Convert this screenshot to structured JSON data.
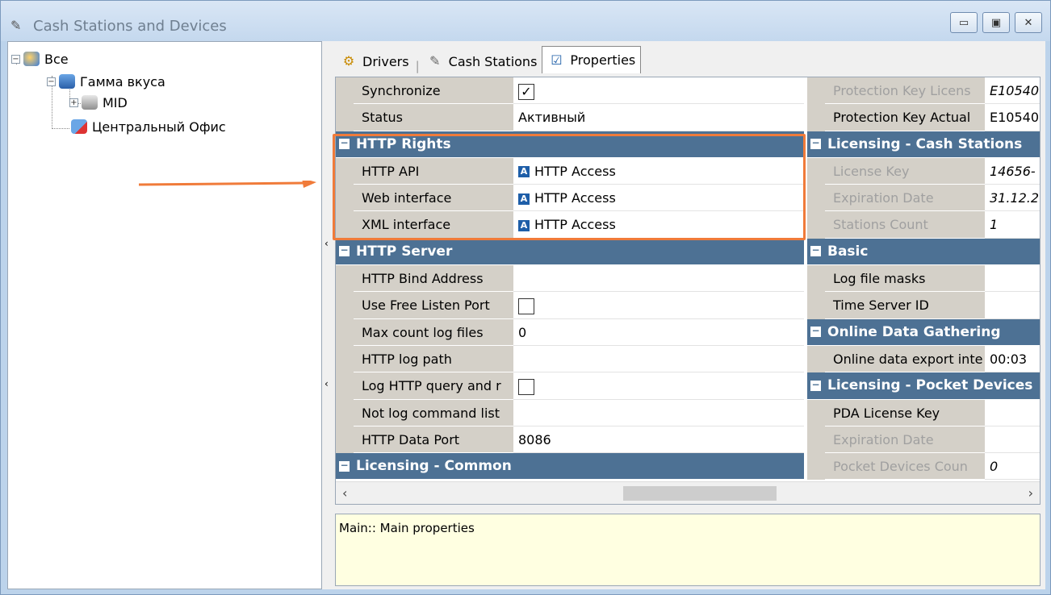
{
  "window": {
    "title": "Cash Stations and Devices",
    "title_icon": "cash-station-icon",
    "buttons": {
      "minimize": "▭",
      "maximize": "▣",
      "close": "✕"
    }
  },
  "tree": {
    "root": {
      "label": "Все",
      "icon": "globe-group-icon"
    },
    "group": {
      "label": "Гамма вкуса",
      "icon": "group-icon"
    },
    "child": {
      "label": "MID",
      "icon": "cash-register-icon"
    },
    "office": {
      "label": "Центральный Офис",
      "icon": "office-icon"
    }
  },
  "tabs": [
    {
      "label": "Drivers",
      "icon": "drivers-icon"
    },
    {
      "label": "Cash Stations",
      "icon": "cash-station-icon"
    },
    {
      "label": "Properties",
      "icon": "properties-icon"
    }
  ],
  "grid_left": {
    "synchronize": {
      "name": "Synchronize",
      "checked": true
    },
    "status": {
      "name": "Status",
      "value": "Активный"
    },
    "cat_http_rights": "HTTP Rights",
    "http_api": {
      "name": "HTTP API",
      "value": "HTTP Access"
    },
    "web_interface": {
      "name": "Web interface",
      "value": "HTTP Access"
    },
    "xml_interface": {
      "name": "XML interface",
      "value": "HTTP Access"
    },
    "cat_http_server": "HTTP Server",
    "bind_address": {
      "name": "HTTP Bind Address",
      "value": ""
    },
    "free_port": {
      "name": "Use Free Listen Port",
      "checked": false
    },
    "max_log": {
      "name": "Max count log files",
      "value": "0"
    },
    "log_path": {
      "name": "HTTP log path",
      "value": ""
    },
    "log_query": {
      "name": "Log HTTP query and r",
      "checked": false
    },
    "not_log": {
      "name": "Not log command list",
      "value": ""
    },
    "data_port": {
      "name": "HTTP Data Port",
      "value": "8086"
    },
    "cat_licensing_common": "Licensing - Common"
  },
  "grid_right": {
    "prot_key_license": {
      "name": "Protection Key Licens",
      "value": "E10540"
    },
    "prot_key_actual": {
      "name": "Protection Key Actual",
      "value": "E10540"
    },
    "cat_lic_cash": "Licensing - Cash Stations",
    "license_key": {
      "name": "License Key",
      "value": "14656-"
    },
    "exp_date": {
      "name": "Expiration Date",
      "value": "31.12.2"
    },
    "stations_count": {
      "name": "Stations Count",
      "value": "1"
    },
    "cat_basic": "Basic",
    "log_masks": {
      "name": "Log file masks",
      "value": ""
    },
    "time_server": {
      "name": "Time Server ID",
      "value": ""
    },
    "cat_online": "Online Data Gathering",
    "online_export": {
      "name": "Online data export inte",
      "value": "00:03"
    },
    "cat_lic_pocket": "Licensing - Pocket Devices",
    "pda_key": {
      "name": "PDA License Key",
      "value": ""
    },
    "pda_exp": {
      "name": "Expiration Date",
      "value": ""
    },
    "pocket_count": {
      "name": "Pocket Devices Coun",
      "value": "0"
    }
  },
  "description": "Main:: Main properties",
  "colors": {
    "category": "#4d7194",
    "highlight": "#f07b3a",
    "description_bg": "#ffffe1"
  }
}
